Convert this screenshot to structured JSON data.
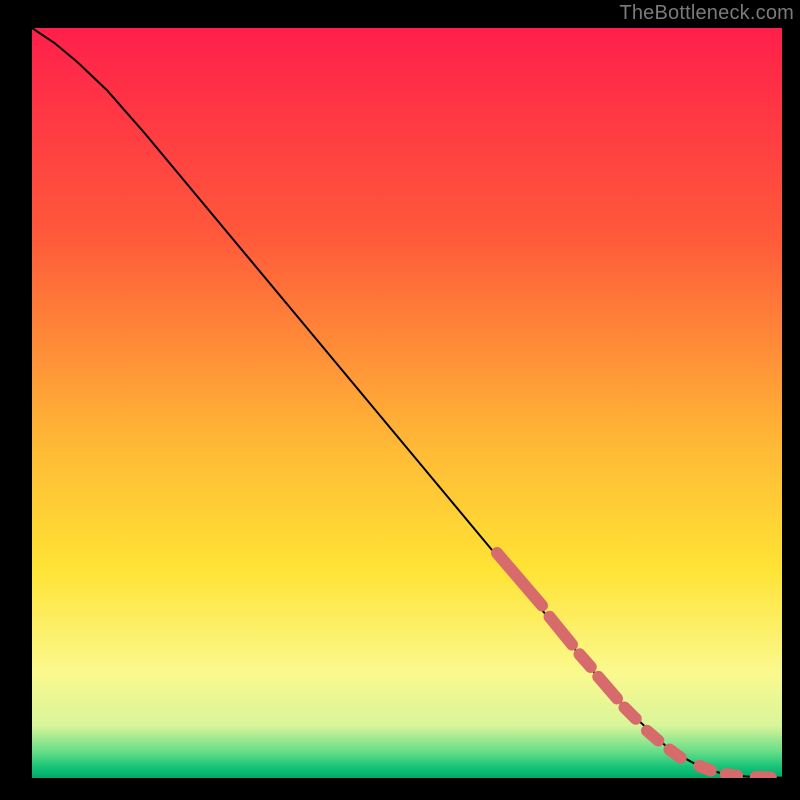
{
  "watermark": "TheBottleneck.com",
  "chart_data": {
    "type": "line",
    "title": "",
    "xlabel": "",
    "ylabel": "",
    "xlim": [
      0,
      100
    ],
    "ylim": [
      0,
      100
    ],
    "grid": false,
    "legend": false,
    "gradient_stops": [
      {
        "offset": 0.0,
        "color": "#ff1f4b"
      },
      {
        "offset": 0.28,
        "color": "#ff5a3a"
      },
      {
        "offset": 0.55,
        "color": "#ffb736"
      },
      {
        "offset": 0.72,
        "color": "#ffe334"
      },
      {
        "offset": 0.86,
        "color": "#fbf98e"
      },
      {
        "offset": 0.93,
        "color": "#d9f59a"
      },
      {
        "offset": 0.965,
        "color": "#66dd88"
      },
      {
        "offset": 0.985,
        "color": "#17c477"
      },
      {
        "offset": 1.0,
        "color": "#00a86b"
      }
    ],
    "series": [
      {
        "name": "curve",
        "stroke": "#000000",
        "x": [
          0,
          3,
          6,
          10,
          15,
          20,
          25,
          30,
          35,
          40,
          45,
          50,
          55,
          60,
          65,
          70,
          75,
          80,
          85,
          88,
          90,
          92,
          94,
          96,
          98,
          100
        ],
        "y": [
          100,
          98,
          95.5,
          91.7,
          86.0,
          80.0,
          74.0,
          68.0,
          62.0,
          56.0,
          50.0,
          44.0,
          38.0,
          32.0,
          26.0,
          20.0,
          14.0,
          8.5,
          3.8,
          2.1,
          1.2,
          0.6,
          0.3,
          0.15,
          0.07,
          0.05
        ]
      }
    ],
    "markers": {
      "stroke": "#d76a6a",
      "stroke_width": 12,
      "segments": [
        {
          "x0": 62,
          "y0": 30.0,
          "x1": 68,
          "y1": 23.0
        },
        {
          "x0": 69,
          "y0": 21.5,
          "x1": 72,
          "y1": 17.8
        },
        {
          "x0": 73,
          "y0": 16.5,
          "x1": 74.5,
          "y1": 14.8
        },
        {
          "x0": 75.5,
          "y0": 13.5,
          "x1": 78,
          "y1": 10.6
        },
        {
          "x0": 79,
          "y0": 9.4,
          "x1": 80.5,
          "y1": 7.9
        },
        {
          "x0": 82,
          "y0": 6.3,
          "x1": 83.5,
          "y1": 5.0
        },
        {
          "x0": 85,
          "y0": 3.8,
          "x1": 86.5,
          "y1": 2.7
        },
        {
          "x0": 89,
          "y0": 1.6,
          "x1": 90.5,
          "y1": 1.0
        },
        {
          "x0": 92.5,
          "y0": 0.5,
          "x1": 94,
          "y1": 0.3
        },
        {
          "x0": 96.5,
          "y0": 0.12,
          "x1": 98.5,
          "y1": 0.07
        }
      ]
    }
  }
}
